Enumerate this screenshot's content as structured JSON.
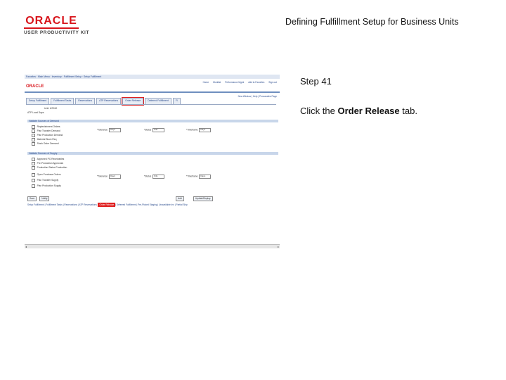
{
  "logo": {
    "brand": "ORACLE",
    "product": "USER PRODUCTIVITY KIT"
  },
  "doc_title": "Defining Fulfillment Setup for Business Units",
  "step": "Step 41",
  "instruction": {
    "prefix": "Click the ",
    "bold": "Order Release",
    "suffix": " tab."
  },
  "screenshot": {
    "breadcrumbs": "Favorites  ·  Main Menu  ·  Inventory  ·  Fulfillment Setup  ·  Setup Fulfillment",
    "brand": "ORACLE",
    "top_links": [
      "Home",
      "Worklist",
      "Performance Mgmt",
      "Add to Favorites",
      "Sign out"
    ],
    "right_links": "New Window | Help | Personalize Page",
    "tabs": [
      "Setup Fulfillment",
      "Fulfillment Tasks",
      "Reservations",
      "ATP Reservations",
      "Order Release",
      "Deferred Fulfillment",
      "Fl"
    ],
    "active_tab": "Order Release",
    "unit_label": "Unit:  US010",
    "load_label": "ATP Load Days",
    "section1": "Validate Sources of Demand",
    "demand_items": [
      "Replenishment Orders",
      "Plan Transfer Demand",
      "Plan Production Demand",
      "Material Stock Req",
      "Stock Order Demand"
    ],
    "section2": "Validate Sources of Supply",
    "supply_items": [
      "Approved PO Receivables",
      "Pre-Production Approvals",
      "Production Status Production",
      "Open Purchase Orders",
      "Plan Transfer Supply",
      "Plan Production Supply"
    ],
    "field_labels": {
      "tolerance": "*Tolerance",
      "status": "*Status",
      "timeframe": "*Timeframe"
    },
    "field_values": [
      "Days",
      "Fifo",
      "Days"
    ],
    "buttons": [
      "Save",
      "Notify"
    ],
    "right_buttons": [
      "Add",
      "Update/Display"
    ],
    "footer_links_pre": "Setup Fulfillment | Fulfillment Tasks | Reservations | ATP Reservations | ",
    "footer_links_hl": "Order Release",
    "footer_links_post": " | Deferred Fulfillment | Pre-Picked Staging | Unavailable Inv | Partial Ship"
  }
}
